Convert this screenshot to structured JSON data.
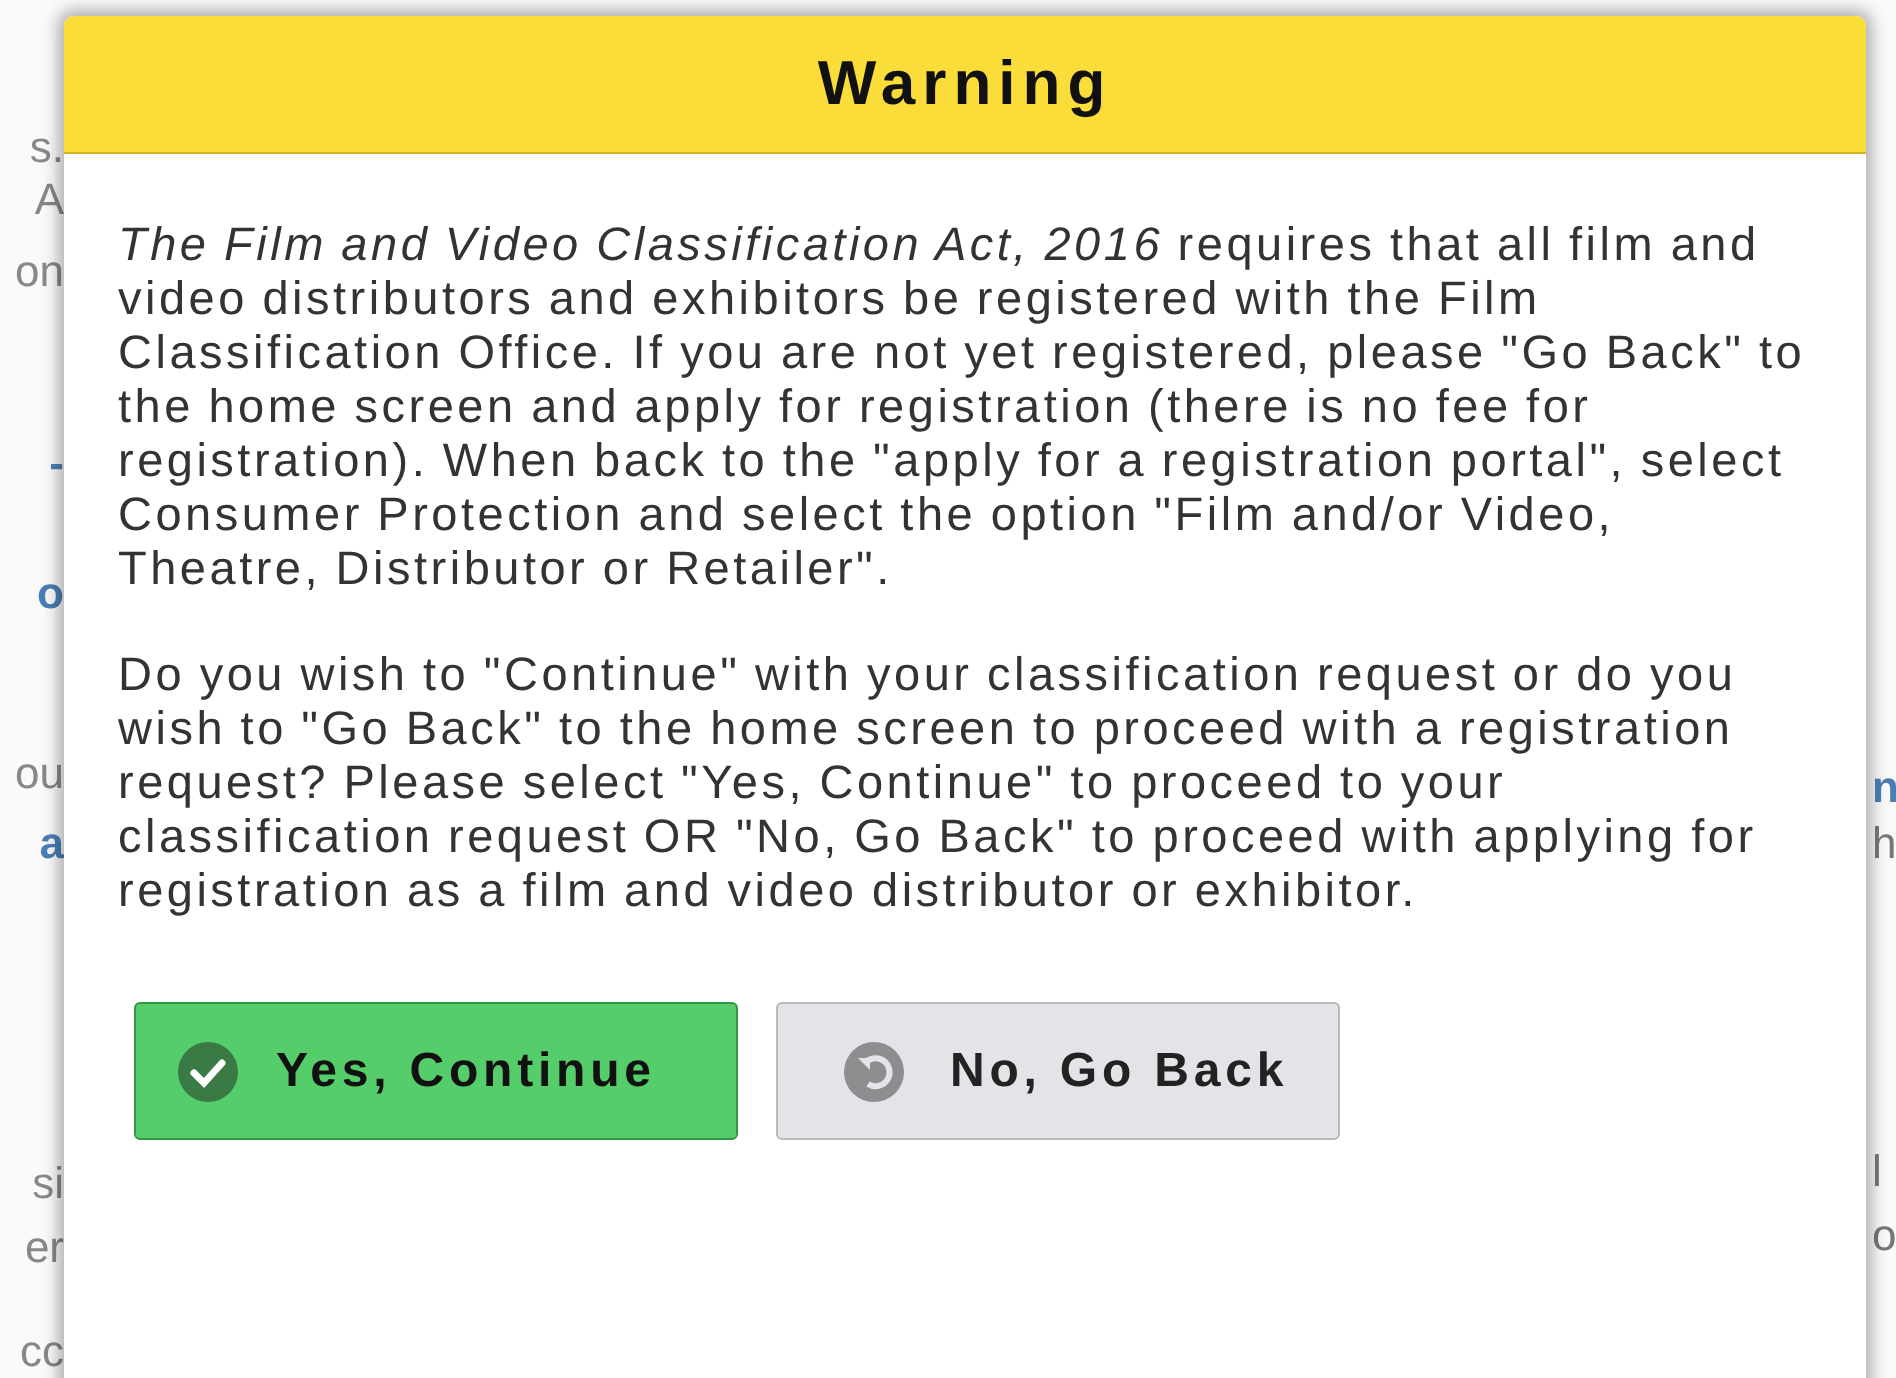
{
  "background": {
    "left_fragments": [
      "s.",
      "A",
      "on",
      "-",
      "o",
      "ou",
      "a",
      "si",
      "er",
      "cc"
    ],
    "right_fragments": [
      "n",
      "h",
      "l",
      "o"
    ]
  },
  "dialog": {
    "title": "Warning",
    "paragraphs": [
      "*The Film and Video Classification Act, 2016* requires that all film and video distributors and exhibitors be registered with the Film Classification Office. If you are not yet registered, please \"Go Back\" to the home screen and apply for registration (there is no fee for registration). When back to the \"apply for a registration portal\", select Consumer Protection and select the option \"Film and/or Video, Theatre, Distributor or Retailer\".",
      "Do you wish to \"Continue\" with your classification request or do you wish to \"Go Back\" to the home screen to proceed with a registration request? Please select \"Yes, Continue\" to proceed to your classification request OR \"No, Go Back\" to proceed with applying for registration as a film and video distributor or exhibitor."
    ],
    "buttons": [
      {
        "kind": "confirm",
        "label": "Yes, Continue"
      },
      {
        "kind": "back",
        "label": "No, Go Back"
      }
    ]
  }
}
